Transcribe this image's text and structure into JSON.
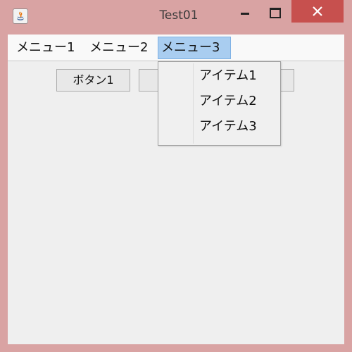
{
  "window": {
    "title": "Test01",
    "accent_close": "#c7504e",
    "frame_color": "#d9a3a3"
  },
  "menubar": {
    "menus": [
      {
        "label": "メニュー1"
      },
      {
        "label": "メニュー2"
      },
      {
        "label": "メニュー3",
        "selected": true
      }
    ]
  },
  "buttons": [
    {
      "label": "ボタン1"
    },
    {
      "label": ""
    }
  ],
  "popup_menu": {
    "items": [
      {
        "label": "アイテム1"
      },
      {
        "label": "アイテム2"
      },
      {
        "label": "アイテム3"
      }
    ]
  }
}
